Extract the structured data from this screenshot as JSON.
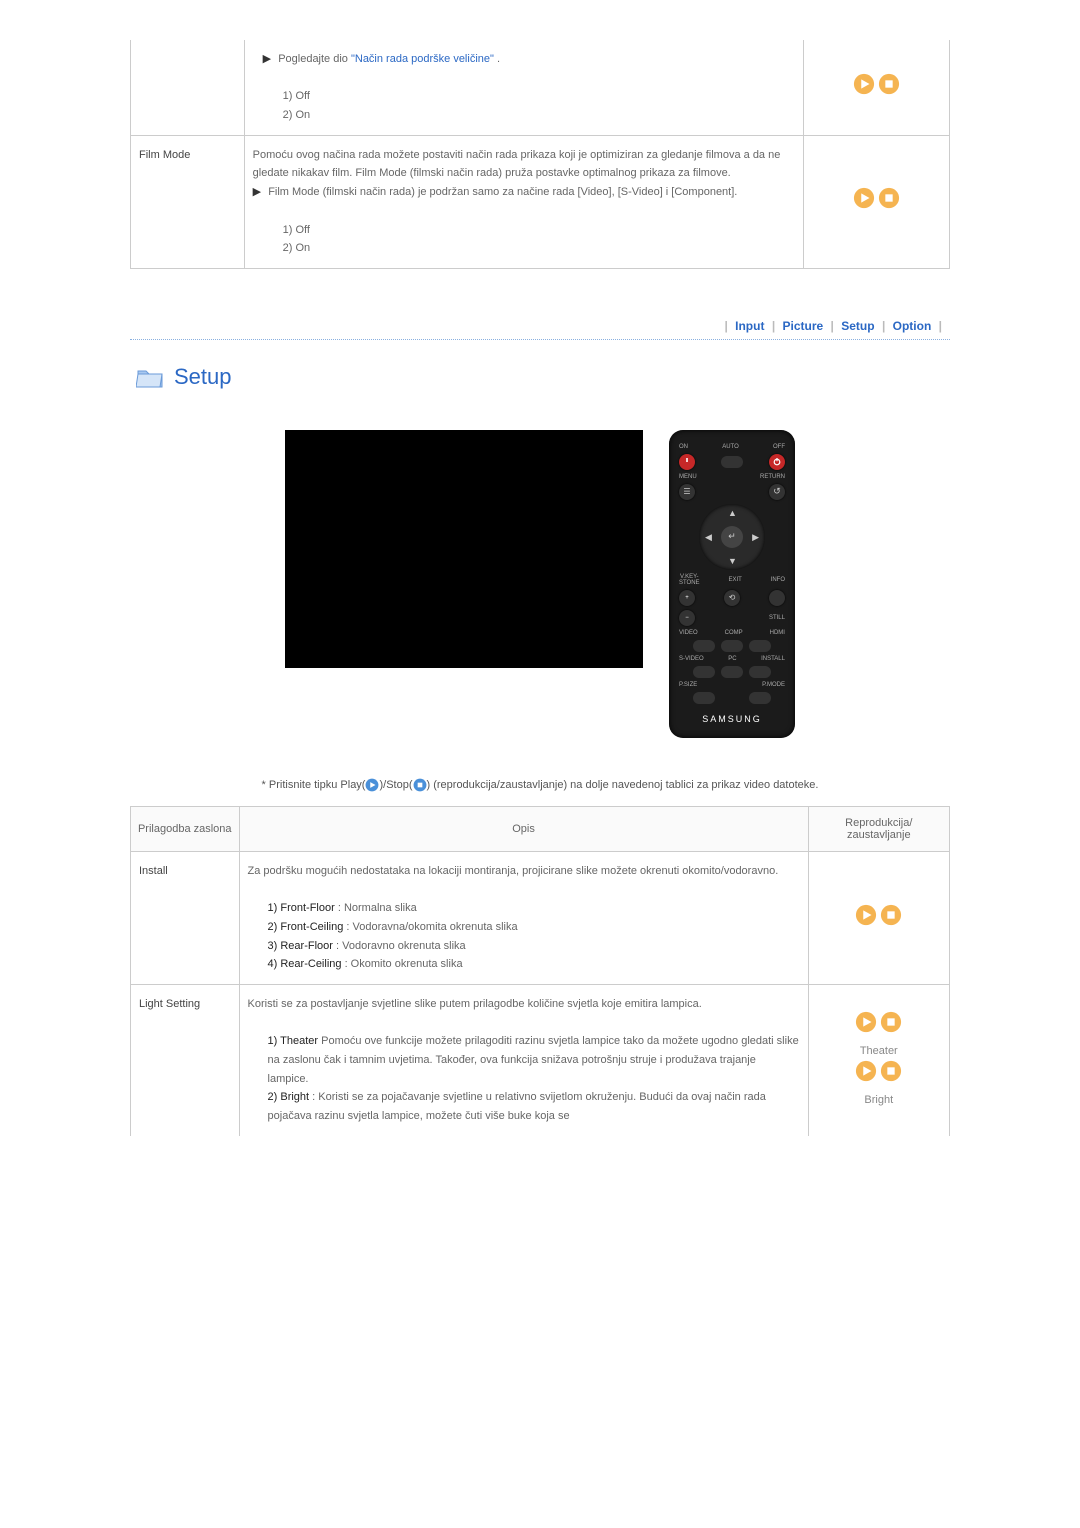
{
  "table1": {
    "row_size": {
      "prefix": "Pogledajte dio ",
      "link": "\"Način rada podrške veličine\"",
      "suffix": ".",
      "opt1": "1) Off",
      "opt2": "2) On"
    },
    "row_film": {
      "label": "Film Mode",
      "desc1": "Pomoću ovog načina rada možete postaviti način rada prikaza koji je optimiziran za gledanje filmova a da ne gledate nikakav film. Film Mode (filmski način rada) pruža postavke optimalnog prikaza za filmove.",
      "desc2": "Film Mode (filmski način rada) je podržan samo za načine rada [Video], [S-Video] i [Component].",
      "opt1": "1) Off",
      "opt2": "2) On"
    }
  },
  "nav": {
    "input": "Input",
    "picture": "Picture",
    "setup": "Setup",
    "option": "Option"
  },
  "setup_heading": "Setup",
  "remote": {
    "brand": "SAMSUNG",
    "on": "ON",
    "off": "OFF",
    "auto": "AUTO",
    "menu": "MENU",
    "return": "RETURN",
    "exit": "EXIT",
    "info": "INFO",
    "still": "STILL",
    "key": "V.KEY-\nSTONE",
    "video": "VIDEO",
    "comp": "COMP",
    "hdmi": "HDMI",
    "svideo": "S-VIDEO",
    "pc": "PC",
    "install": "INSTALL",
    "psize": "P.SIZE",
    "pmode": "P.MODE"
  },
  "instruction": {
    "prefix": "* Pritisnite tipku Play(",
    "middle": ")/Stop(",
    "suffix": ") (reprodukcija/zaustavljanje) na dolje navedenoj tablici za prikaz video datoteke."
  },
  "table2": {
    "headers": {
      "adjust": "Prilagodba zaslona",
      "desc": "Opis",
      "play": "Reprodukcija/\nzaustavljanje"
    },
    "install": {
      "label": "Install",
      "desc": "Za podršku mogućih nedostataka na lokaciji montiranja, projicirane slike možete okrenuti okomito/vodoravno.",
      "opt1a": "1) Front-Floor",
      "opt1b": " : Normalna slika",
      "opt2a": "2) Front-Ceiling",
      "opt2b": " : Vodoravna/okomita okrenuta slika",
      "opt3a": "3) Rear-Floor",
      "opt3b": " : Vodoravno okrenuta slika",
      "opt4a": "4) Rear-Ceiling",
      "opt4b": " : Okomito okrenuta slika"
    },
    "light": {
      "label": "Light Setting",
      "desc": "Koristi se za postavljanje svjetline slike putem prilagodbe količine svjetla koje emitira lampica.",
      "opt1a": "1) Theater",
      "opt1b": " Pomoću ove funkcije možete prilagoditi razinu svjetla lampice tako da možete ugodno gledati slike na zaslonu čak i tamnim uvjetima. Također, ova funkcija snižava potrošnju struje i produžava trajanje lampice.",
      "opt2a": "2) Bright",
      "opt2b": " : Koristi se za pojačavanje svjetline u relativno svijetlom okruženju. Budući da ovaj način rada pojačava razinu svjetla lampice, možete čuti više buke koja se",
      "play_label1": "Theater",
      "play_label2": "Bright"
    }
  }
}
